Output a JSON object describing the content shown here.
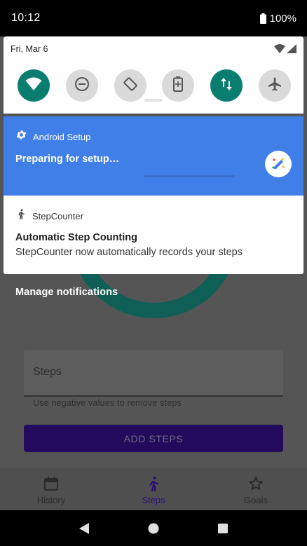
{
  "status_bar": {
    "time": "10:12",
    "battery": "100%"
  },
  "quick_settings": {
    "date": "Fri, Mar 6",
    "tiles": [
      {
        "icon": "wifi-icon",
        "on": true
      },
      {
        "icon": "do-not-disturb-icon",
        "on": false
      },
      {
        "icon": "auto-rotate-icon",
        "on": false
      },
      {
        "icon": "battery-saver-icon",
        "on": false
      },
      {
        "icon": "mobile-data-icon",
        "on": true
      },
      {
        "icon": "airplane-mode-icon",
        "on": false
      }
    ]
  },
  "notifications": {
    "setup": {
      "app": "Android Setup",
      "title": "Preparing for setup…",
      "icon": "gear-icon"
    },
    "stepcounter": {
      "app": "StepCounter",
      "title": "Automatic Step Counting",
      "text": "StepCounter now automatically records your steps",
      "icon": "walking-icon"
    },
    "manage_label": "Manage notifications"
  },
  "app": {
    "steps_field_label": "Steps",
    "helper_text": "Use negative values to remove steps",
    "add_button_label": "ADD STEPS",
    "nav": [
      {
        "label": "History",
        "icon": "calendar-icon"
      },
      {
        "label": "Steps",
        "icon": "walking-icon",
        "active": true
      },
      {
        "label": "Goals",
        "icon": "star-icon"
      }
    ]
  },
  "colors": {
    "accent_teal": "#0a7d71",
    "setup_blue": "#3f7fe7",
    "primary_purple": "#230a5c"
  }
}
